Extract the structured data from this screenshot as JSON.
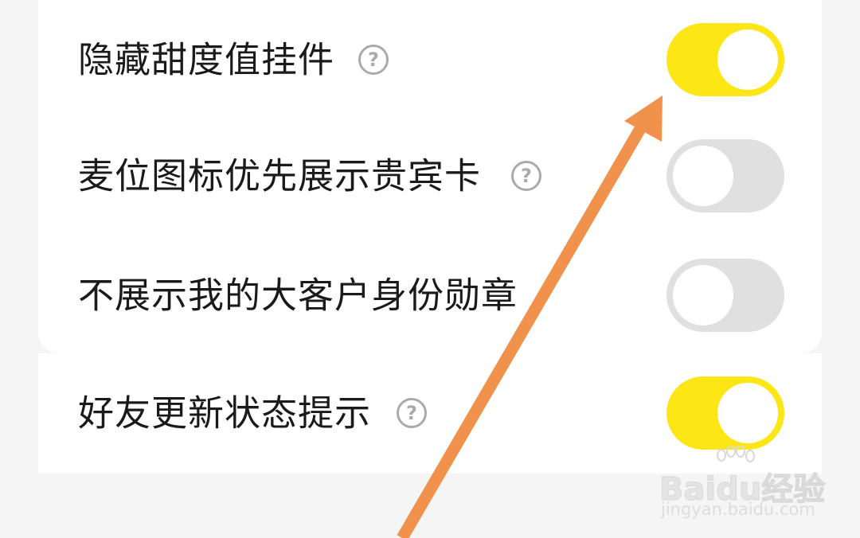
{
  "settings": [
    {
      "label": "隐藏甜度值挂件",
      "has_help": true,
      "help_icon": "?",
      "enabled": true
    },
    {
      "label": "麦位图标优先展示贵宾卡",
      "has_help": true,
      "help_icon": "?",
      "enabled": false
    },
    {
      "label": "不展示我的大客户身份勋章",
      "has_help": false,
      "enabled": false
    },
    {
      "label": "好友更新状态提示",
      "has_help": true,
      "help_icon": "?",
      "enabled": true
    }
  ],
  "watermark": {
    "logo": "Baidu经验",
    "url": "jingyan.baidu.com"
  },
  "colors": {
    "toggle_on": "#fde616",
    "toggle_off": "#e0e0e0",
    "arrow": "#f0914c",
    "background": "#f5f5f5"
  }
}
